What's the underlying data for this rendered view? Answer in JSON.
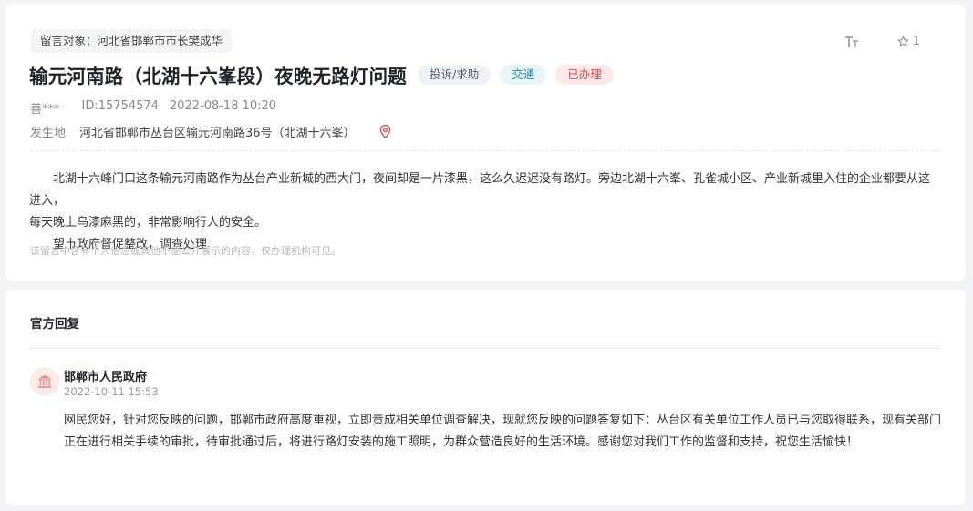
{
  "message": {
    "target": "留言对象：河北省邯郸市市长樊成华",
    "tools": {
      "font_icon_label": "TT",
      "favorite_count": "1"
    },
    "title": "输元河南路（北湖十六峯段）夜晚无路灯问题",
    "tags": {
      "type": "投诉/求助",
      "topic": "交通",
      "status": "已办理"
    },
    "author": "善***",
    "id": "ID:15754574",
    "time": "2022-08-18 10:20",
    "location_label": "发生地",
    "location": "河北省邯郸市丛台区输元河南路36号（北湖十六峯）",
    "paragraph1": "北湖十六峰门口这条输元河南路作为丛台产业新城的西大门，夜间却是一片漆黑，这么久迟迟没有路灯。旁边北湖十六峯、孔雀城小区、产业新城里入住的企业都要从这进入，",
    "paragraph1_cont": "每天晚上乌漆麻黑的，非常影响行人的安全。",
    "paragraph2": "望市政府督促整改，调查处理",
    "privacy_note": "该留言中含有个人信息或其他不便公开展示的内容，仅办理机构可见。"
  },
  "reply": {
    "section_title": "官方回复",
    "org_name": "邯郸市人民政府",
    "time": "2022-10-11 15:53",
    "body": "网民您好，针对您反映的问题，邯郸市政府高度重视，立即责成相关单位调查解决，现就您反映的问题答复如下：丛台区有关单位工作人员已与您取得联系，现有关部门正在进行相关手续的审批，待审批通过后，将进行路灯安装的施工照明，为群众营造良好的生活环境。感谢您对我们工作的监督和支持，祝您生活愉快！"
  },
  "colors": {
    "status_red": "#e0444b",
    "topic_teal": "#2b8aa3",
    "pin_red": "#e54b4b"
  }
}
